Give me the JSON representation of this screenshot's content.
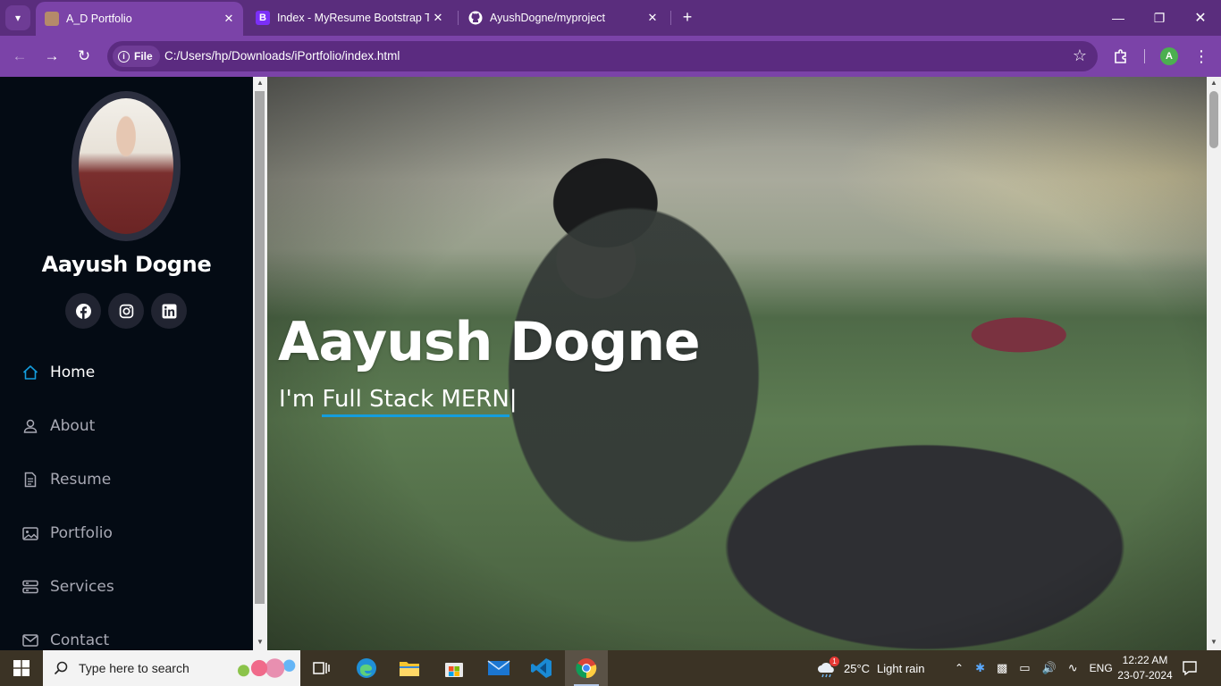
{
  "browser": {
    "tabs": [
      {
        "title": "A_D Portfolio",
        "active": true
      },
      {
        "title": "Index - MyResume Bootstrap Te",
        "active": false
      },
      {
        "title": "AyushDogne/myproject",
        "active": false
      }
    ],
    "address": {
      "scheme_label": "File",
      "url": "C:/Users/hp/Downloads/iPortfolio/index.html"
    },
    "profile_initial": "A"
  },
  "sidebar": {
    "name": "Aayush Dogne",
    "social": [
      "facebook-icon",
      "instagram-icon",
      "linkedin-icon"
    ],
    "nav": [
      {
        "label": "Home",
        "icon": "home-icon",
        "active": true
      },
      {
        "label": "About",
        "icon": "person-icon",
        "active": false
      },
      {
        "label": "Resume",
        "icon": "file-icon",
        "active": false
      },
      {
        "label": "Portfolio",
        "icon": "images-icon",
        "active": false
      },
      {
        "label": "Services",
        "icon": "server-icon",
        "active": false
      },
      {
        "label": "Contact",
        "icon": "envelope-icon",
        "active": false
      }
    ]
  },
  "hero": {
    "name": "Aayush Dogne",
    "prefix": "I'm ",
    "typed": "Full Stack MERN",
    "cursor": "|"
  },
  "taskbar": {
    "search_placeholder": "Type here to search",
    "weather": {
      "temp": "25°C",
      "desc": "Light rain",
      "badge": "1"
    },
    "language": "ENG",
    "time": "12:22 AM",
    "date": "23-07-2024"
  },
  "colors": {
    "accent": "#149ddd",
    "sidebar_bg": "#040b14",
    "browser_tabbar": "#5a2d7d",
    "browser_toolbar": "#7b43a8"
  }
}
